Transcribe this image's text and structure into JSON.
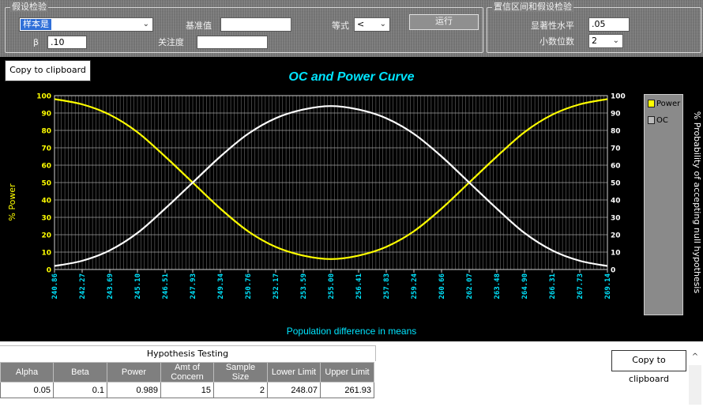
{
  "hypothesis_group": {
    "title": "假设检验",
    "sample_combo": "样本是",
    "benchmark_label": "基准值",
    "benchmark_value": "",
    "equation_label": "等式",
    "equation_value": "<",
    "run_label": "运行",
    "beta_label": "β",
    "beta_value": ".10",
    "concern_label": "关注度",
    "concern_value": ""
  },
  "confidence_group": {
    "title": "置信区间和假设检验",
    "significance_label": "显著性水平",
    "significance_value": ".05",
    "decimals_label": "小数位数",
    "decimals_value": "2"
  },
  "chart_panel": {
    "copy_label": "Copy to clipboard"
  },
  "chart_data": {
    "type": "line",
    "title": "OC and Power Curve",
    "xlabel": "Population difference in means",
    "ylabel": "% Power",
    "y2label": "% Probability of accepting null hypothesis",
    "ylim": [
      0,
      100
    ],
    "yticks": [
      0,
      10,
      20,
      30,
      40,
      50,
      60,
      70,
      80,
      90,
      100
    ],
    "categories": [
      "240.86",
      "242.27",
      "243.69",
      "245.10",
      "246.51",
      "247.93",
      "249.34",
      "250.76",
      "252.17",
      "253.59",
      "255.00",
      "256.41",
      "257.83",
      "259.24",
      "260.66",
      "262.07",
      "263.48",
      "264.90",
      "266.31",
      "267.73",
      "269.14"
    ],
    "series": [
      {
        "name": "Power",
        "color": "#ffff00",
        "values": [
          98,
          95,
          89,
          79,
          65,
          50,
          35,
          22,
          13,
          8,
          6,
          8,
          13,
          22,
          35,
          50,
          65,
          79,
          89,
          95,
          98
        ]
      },
      {
        "name": "OC",
        "color": "#ffffff",
        "values": [
          2,
          5,
          11,
          21,
          35,
          50,
          65,
          78,
          87,
          92,
          94,
          92,
          87,
          78,
          65,
          50,
          35,
          21,
          11,
          5,
          2
        ]
      }
    ],
    "grid": true,
    "legend": "right"
  },
  "table": {
    "title": "Hypothesis Testing",
    "columns": [
      "Alpha",
      "Beta",
      "Power",
      "Amt of Concern",
      "Sample Size",
      "Lower Limit",
      "Upper Limit"
    ],
    "rows": [
      [
        "0.05",
        "0.1",
        "0.989",
        "15",
        "2",
        "248.07",
        "261.93"
      ]
    ]
  },
  "table_panel": {
    "copy_label": "Copy to clipboard"
  },
  "colors": {
    "power": "#ffff00",
    "oc": "#ffffff",
    "axis_labels": "#00e5ff",
    "title": "#00e5ff",
    "plot_bg": "#000000"
  }
}
